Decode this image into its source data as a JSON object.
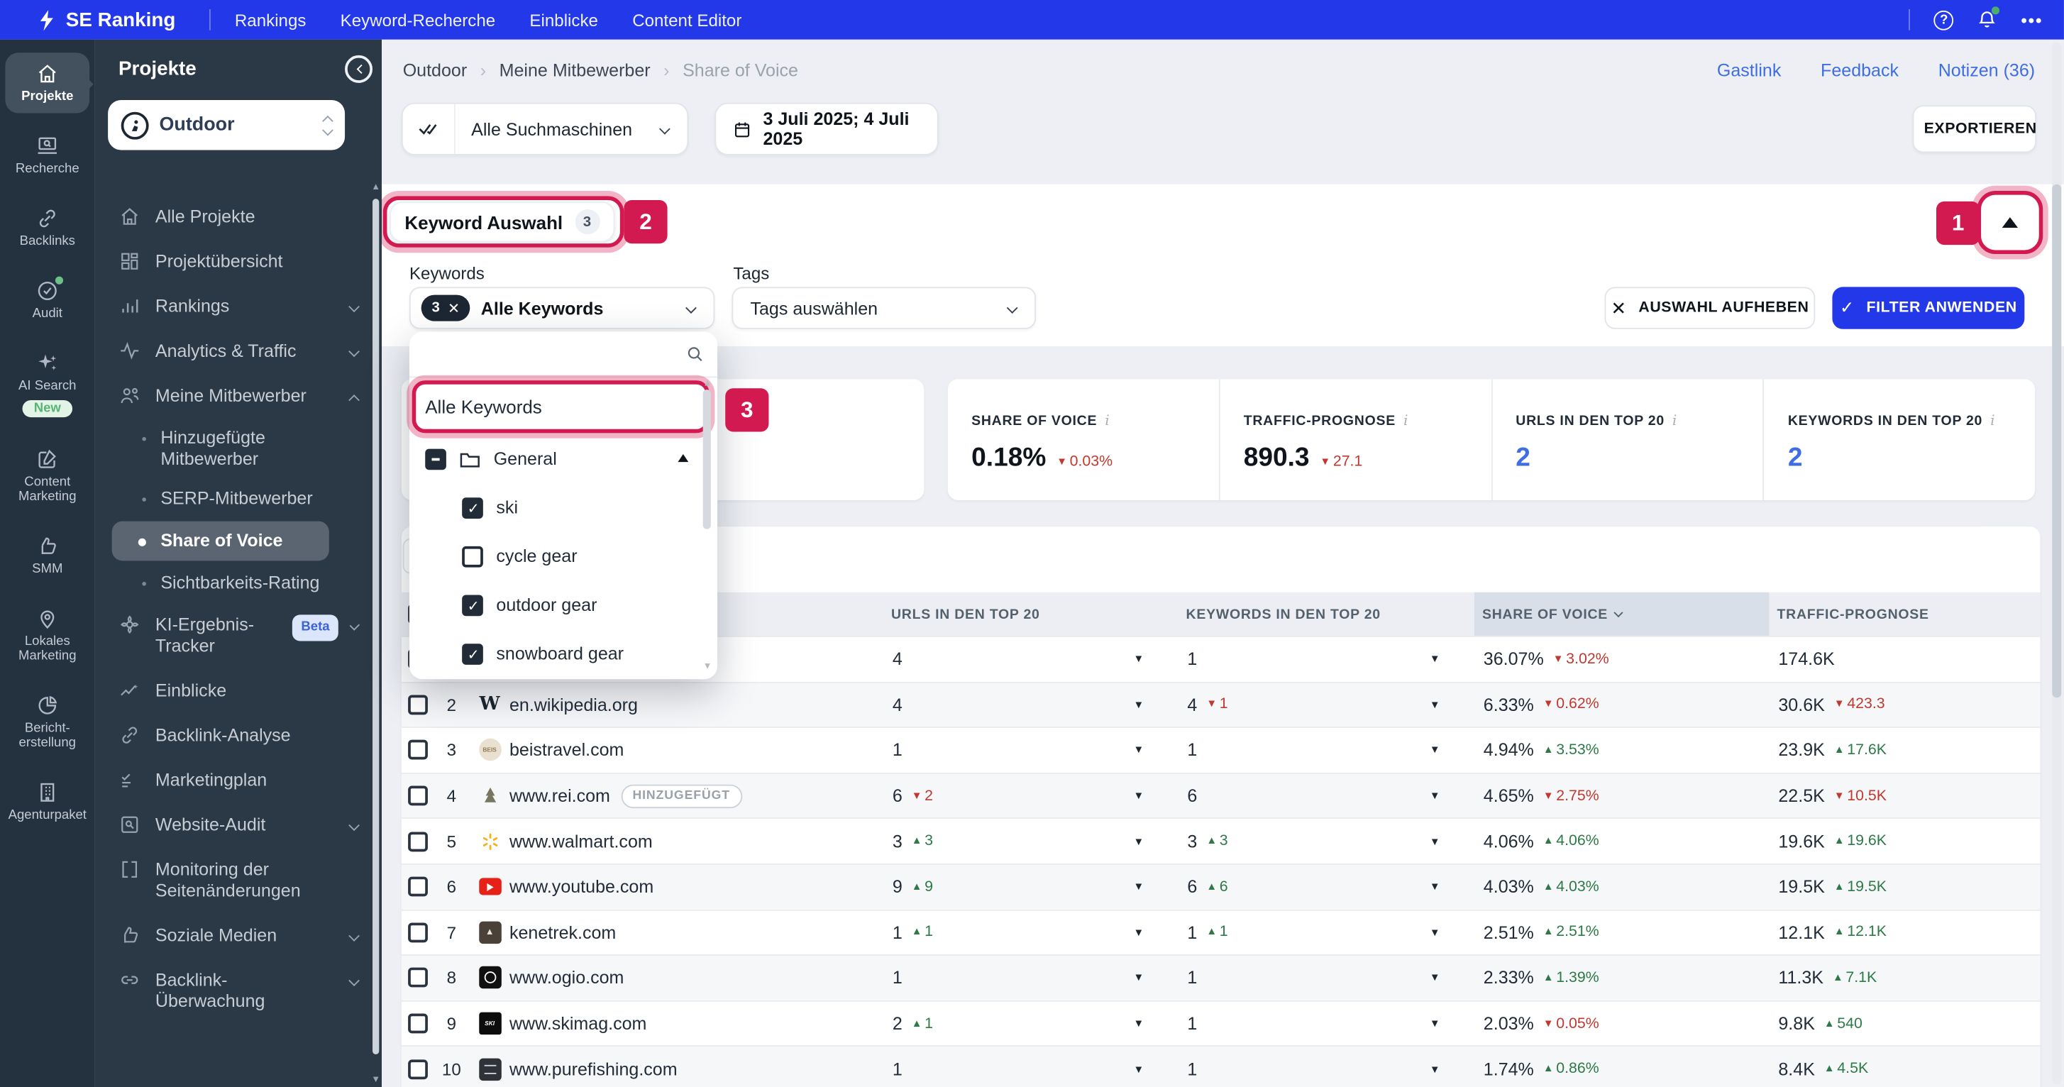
{
  "annotations": {
    "one": "1",
    "two": "2",
    "three": "3"
  },
  "topbar": {
    "brand": "SE Ranking",
    "nav": [
      "Rankings",
      "Keyword-Recherche",
      "Einblicke",
      "Content Editor"
    ]
  },
  "rail": {
    "items": [
      "Projekte",
      "Recherche",
      "Backlinks",
      "Audit",
      "AI Search",
      "Content Marketing",
      "SMM",
      "Lokales Marketing",
      "Bericht-erstellung",
      "Agenturpaket"
    ],
    "new_badge": "New"
  },
  "sidebar": {
    "title": "Projekte",
    "project": "Outdoor",
    "menu": [
      {
        "label": "Alle Projekte"
      },
      {
        "label": "Projektübersicht"
      },
      {
        "label": "Rankings"
      },
      {
        "label": "Analytics & Traffic"
      },
      {
        "label": "Meine Mitbewerber",
        "children": [
          {
            "label": "Hinzugefügte Mitbewerber"
          },
          {
            "label": "SERP-Mitbewerber"
          },
          {
            "label": "Share of Voice"
          },
          {
            "label": "Sichtbarkeits-Rating"
          }
        ]
      },
      {
        "label": "KI-Ergebnis-Tracker",
        "badge": "Beta"
      },
      {
        "label": "Einblicke"
      },
      {
        "label": "Backlink-Analyse"
      },
      {
        "label": "Marketingplan"
      },
      {
        "label": "Website-Audit"
      },
      {
        "label": "Monitoring der Seitenänderungen"
      },
      {
        "label": "Soziale Medien"
      },
      {
        "label": "Backlink-Überwachung"
      }
    ]
  },
  "header": {
    "breadcrumb": [
      "Outdoor",
      "Meine Mitbewerber",
      "Share of Voice"
    ],
    "links": [
      "Gastlink",
      "Feedback",
      "Notizen (36)"
    ],
    "search_engines": "Alle Suchmaschinen",
    "date_range": "3 Juli 2025; 4 Juli 2025",
    "export_label": "EXPORTIEREN"
  },
  "filter": {
    "title": "Keyword Auswahl",
    "count": "3",
    "keywords_label": "Keywords",
    "tags_label": "Tags",
    "selected_count": "3",
    "keywords_value": "Alle Keywords",
    "tags_placeholder": "Tags auswählen",
    "clear_label": "AUSWAHL AUFHEBEN",
    "apply_label": "FILTER ANWENDEN"
  },
  "dropdown": {
    "all_keywords": "Alle Keywords",
    "group": "General",
    "items": [
      {
        "label": "ski",
        "checked": true
      },
      {
        "label": "cycle gear",
        "checked": false
      },
      {
        "label": "outdoor gear",
        "checked": true
      },
      {
        "label": "snowboard gear",
        "checked": true
      }
    ]
  },
  "stats": [
    {
      "label": "SHARE OF VOICE",
      "value": "0.18%",
      "change": "0.03%",
      "dir": "down"
    },
    {
      "label": "TRAFFIC-PROGNOSE",
      "value": "890.3",
      "change": "27.1",
      "dir": "down"
    },
    {
      "label": "URLS IN DEN TOP 20",
      "value": "2"
    },
    {
      "label": "KEYWORDS IN DEN TOP 20",
      "value": "2"
    }
  ],
  "table": {
    "headers": {
      "urls": "URLS IN DEN TOP 20",
      "keywords": "KEYWORDS IN DEN TOP 20",
      "sov": "SHARE OF VOICE",
      "traffic": "TRAFFIC-PROGNOSE"
    },
    "added_badge": "HINZUGEFÜGT",
    "rows": [
      {
        "rank": "1",
        "domain": "",
        "urls": "4",
        "kw": "1",
        "sov": "36.07%",
        "sov_chg": "3.02%",
        "traffic": "174.6K"
      },
      {
        "rank": "2",
        "domain": "en.wikipedia.org",
        "fav": "W",
        "urls": "4",
        "kw": "4",
        "kw_chg": "1",
        "sov": "6.33%",
        "sov_chg": "0.62%",
        "traffic": "30.6K",
        "traffic_chg": "423.3"
      },
      {
        "rank": "3",
        "domain": "beistravel.com",
        "fav": "BEIS",
        "urls": "1",
        "kw": "1",
        "sov": "4.94%",
        "sov_chg": "3.53%",
        "traffic": "23.9K",
        "traffic_chg": "17.6K"
      },
      {
        "rank": "4",
        "domain": "www.rei.com",
        "urls": "6",
        "urls_chg": "2",
        "kw": "6",
        "sov": "4.65%",
        "sov_chg": "2.75%",
        "traffic": "22.5K",
        "traffic_chg": "10.5K"
      },
      {
        "rank": "5",
        "domain": "www.walmart.com",
        "urls": "3",
        "urls_chg": "3",
        "kw": "3",
        "kw_chg": "3",
        "sov": "4.06%",
        "sov_chg": "4.06%",
        "traffic": "19.6K",
        "traffic_chg": "19.6K"
      },
      {
        "rank": "6",
        "domain": "www.youtube.com",
        "urls": "9",
        "urls_chg": "9",
        "kw": "6",
        "kw_chg": "6",
        "sov": "4.03%",
        "sov_chg": "4.03%",
        "traffic": "19.5K",
        "traffic_chg": "19.5K"
      },
      {
        "rank": "7",
        "domain": "kenetrek.com",
        "urls": "1",
        "urls_chg": "1",
        "kw": "1",
        "kw_chg": "1",
        "sov": "2.51%",
        "sov_chg": "2.51%",
        "traffic": "12.1K",
        "traffic_chg": "12.1K"
      },
      {
        "rank": "8",
        "domain": "www.ogio.com",
        "urls": "1",
        "kw": "1",
        "sov": "2.33%",
        "sov_chg": "1.39%",
        "traffic": "11.3K",
        "traffic_chg": "7.1K"
      },
      {
        "rank": "9",
        "domain": "www.skimag.com",
        "fav": "SKI",
        "urls": "2",
        "urls_chg": "1",
        "kw": "1",
        "sov": "2.03%",
        "sov_chg": "0.05%",
        "traffic": "9.8K",
        "traffic_chg": "540"
      },
      {
        "rank": "10",
        "domain": "www.purefishing.com",
        "urls": "1",
        "kw": "1",
        "sov": "1.74%",
        "sov_chg": "0.86%",
        "traffic": "8.4K",
        "traffic_chg": "4.5K"
      }
    ]
  }
}
